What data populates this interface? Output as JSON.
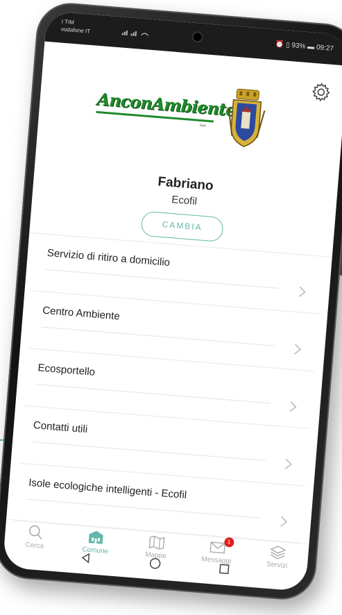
{
  "status_bar": {
    "carrier_line1": "I TIM",
    "carrier_line2": "vodafone IT",
    "battery": "93%",
    "time": "09:27"
  },
  "header": {
    "logo_text": "AnconAmbiente",
    "logo_suffix": "SpA"
  },
  "municipality": {
    "city": "Fabriano",
    "provider": "Ecofil",
    "change_label": "CAMBIA"
  },
  "menu": {
    "items": [
      {
        "label": "Servizio di ritiro a domicilio"
      },
      {
        "label": "Centro Ambiente"
      },
      {
        "label": "Ecosportello"
      },
      {
        "label": "Contatti utili"
      },
      {
        "label": "Isole ecologiche intelligenti - Ecofil"
      }
    ]
  },
  "tabs": {
    "search": "Cerca",
    "municipality": "Comune",
    "maps": "Mappe",
    "messages": "Messaggi",
    "messages_badge": "1",
    "services": "Servizi"
  },
  "colors": {
    "accent": "#5fb8a8",
    "logo_green": "#1f8a2a",
    "badge_red": "#e02020"
  }
}
